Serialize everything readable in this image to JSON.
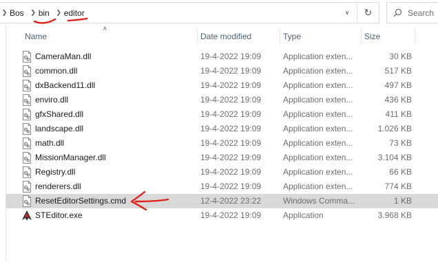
{
  "address": {
    "breadcrumbs": [
      "Bos",
      "bin",
      "editor"
    ]
  },
  "search": {
    "placeholder": "Search"
  },
  "columns": {
    "name": "Name",
    "date": "Date modified",
    "type": "Type",
    "size": "Size"
  },
  "files": [
    {
      "name": "CameraMan.dll",
      "date": "19-4-2022 19:09",
      "type": "Application exten...",
      "size": "30 KB",
      "icon": "dll-file-icon"
    },
    {
      "name": "common.dll",
      "date": "19-4-2022 19:09",
      "type": "Application exten...",
      "size": "517 KB",
      "icon": "dll-file-icon"
    },
    {
      "name": "dxBackend11.dll",
      "date": "19-4-2022 19:09",
      "type": "Application exten...",
      "size": "497 KB",
      "icon": "dll-file-icon"
    },
    {
      "name": "enviro.dll",
      "date": "19-4-2022 19:09",
      "type": "Application exten...",
      "size": "436 KB",
      "icon": "dll-file-icon"
    },
    {
      "name": "gfxShared.dll",
      "date": "19-4-2022 19:09",
      "type": "Application exten...",
      "size": "411 KB",
      "icon": "dll-file-icon"
    },
    {
      "name": "landscape.dll",
      "date": "19-4-2022 19:09",
      "type": "Application exten...",
      "size": "1.026 KB",
      "icon": "dll-file-icon"
    },
    {
      "name": "math.dll",
      "date": "19-4-2022 19:09",
      "type": "Application exten...",
      "size": "73 KB",
      "icon": "dll-file-icon"
    },
    {
      "name": "MissionManager.dll",
      "date": "19-4-2022 19:09",
      "type": "Application exten...",
      "size": "3.104 KB",
      "icon": "dll-file-icon"
    },
    {
      "name": "Registry.dll",
      "date": "19-4-2022 19:09",
      "type": "Application exten...",
      "size": "66 KB",
      "icon": "dll-file-icon"
    },
    {
      "name": "renderers.dll",
      "date": "19-4-2022 19:09",
      "type": "Application exten...",
      "size": "774 KB",
      "icon": "dll-file-icon"
    },
    {
      "name": "ResetEditorSettings.cmd",
      "date": "12-4-2022 23:22",
      "type": "Windows Comma...",
      "size": "1 KB",
      "icon": "cmd-file-icon",
      "selected": true
    },
    {
      "name": "STEditor.exe",
      "date": "19-4-2022 19:09",
      "type": "Application",
      "size": "3.968 KB",
      "icon": "exe-app-icon"
    }
  ],
  "colors": {
    "header_text": "#4c607a",
    "selected_row": "#d9d9d9",
    "annotation": "#e0201b"
  }
}
